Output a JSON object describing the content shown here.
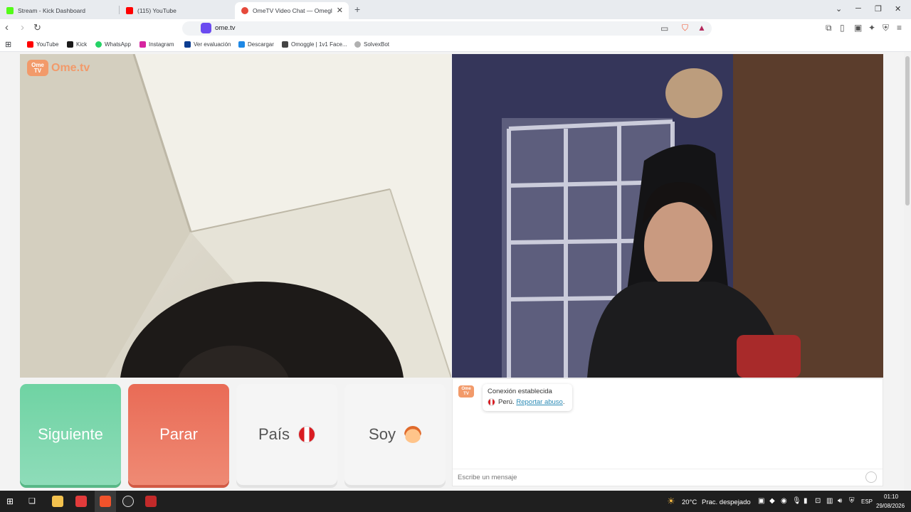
{
  "browser": {
    "tabs": [
      {
        "title": "Stream - Kick Dashboard",
        "color": "#53fc18"
      },
      {
        "title": "(115) YouTube",
        "color": "#ff0000"
      },
      {
        "title": "OmeTV Video Chat — Omegle",
        "color": "#e64a3b"
      }
    ],
    "url": "ome.tv",
    "bookmarks": [
      {
        "label": "YouTube",
        "color": "#ff0000"
      },
      {
        "label": "Kick",
        "color": "#1a1a1a"
      },
      {
        "label": "WhatsApp",
        "color": "#25d366"
      },
      {
        "label": "Instagram",
        "color": "#d6249f"
      },
      {
        "label": "Ver evaluación",
        "color": "#0b3d91"
      },
      {
        "label": "Descargar",
        "color": "#1e88e5"
      },
      {
        "label": "Omoggle | 1v1 Face...",
        "color": "#444444"
      },
      {
        "label": "SolvexBot",
        "color": "#b0b0b0"
      }
    ]
  },
  "site": {
    "logo_badge": "Ome TV",
    "logo_text": "Ome.tv"
  },
  "controls": {
    "next": "Siguiente",
    "stop": "Parar",
    "country": "País",
    "gender": "Soy"
  },
  "chat": {
    "status": "Conexión establecida",
    "country": "Perú.",
    "report": "Reportar abuso",
    "report_suffix": ".",
    "input_placeholder": "Escribe un mensaje"
  },
  "taskbar": {
    "weather_temp": "20°C",
    "weather_desc": "Prac. despejado",
    "language": "ESP",
    "time": "01:10",
    "date": "29/08/2026"
  },
  "colors": {
    "next_button": "#6fd3a3",
    "stop_button": "#e96b56",
    "brand": "#f29a6a",
    "link": "#2a8ab5"
  }
}
